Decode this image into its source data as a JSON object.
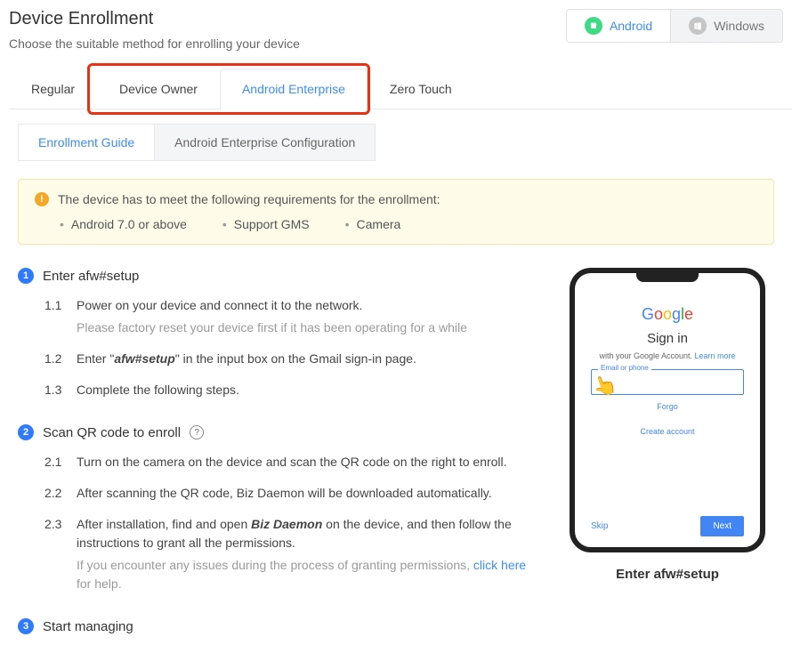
{
  "header": {
    "title": "Device Enrollment",
    "subtitle": "Choose the suitable method for enrolling your device"
  },
  "os_tabs": {
    "android": "Android",
    "windows": "Windows"
  },
  "main_tabs": {
    "regular": "Regular",
    "device_owner": "Device Owner",
    "android_enterprise": "Android Enterprise",
    "zero_touch": "Zero Touch"
  },
  "sub_tabs": {
    "guide": "Enrollment Guide",
    "config": "Android Enterprise Configuration"
  },
  "notice": {
    "heading": "The device has to meet the following requirements for the enrollment:",
    "reqs": [
      "Android 7.0 or above",
      "Support GMS",
      "Camera"
    ]
  },
  "steps": {
    "s1": {
      "title": "Enter afw#setup",
      "items": {
        "n11": "1.1",
        "t11": "Power on your device and connect it to the network.",
        "t11_note": "Please factory reset your device first if it has been operating for a while",
        "n12": "1.2",
        "t12_a": "Enter \"",
        "t12_b": "afw#setup",
        "t12_c": "\" in the input box on the Gmail sign-in page.",
        "n13": "1.3",
        "t13": "Complete the following steps."
      }
    },
    "s2": {
      "title": "Scan QR code to enroll",
      "items": {
        "n21": "2.1",
        "t21": "Turn on the camera on the device and scan the QR code on the right to enroll.",
        "n22": "2.2",
        "t22": "After scanning the QR code, Biz Daemon will be downloaded automatically.",
        "n23": "2.3",
        "t23_a": "After installation, find and open ",
        "t23_b": "Biz Daemon",
        "t23_c": " on the device, and then follow the instructions to grant all the permissions.",
        "t23_note_a": "If you encounter any issues during the process of granting permissions, ",
        "t23_link": "click here",
        "t23_note_b": " for help."
      }
    },
    "s3": {
      "title": "Start managing"
    }
  },
  "phone": {
    "signin": "Sign in",
    "with": "with your Google Account. ",
    "learn": "Learn more",
    "input_label": "Email or phone",
    "forgot": "Forgo",
    "create": "Create account",
    "skip": "Skip",
    "next": "Next",
    "caption": "Enter afw#setup"
  }
}
